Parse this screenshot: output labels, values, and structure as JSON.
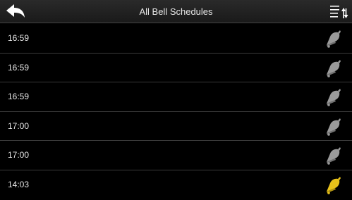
{
  "header": {
    "title": "All Bell Schedules",
    "back_icon": "back-arrow-icon",
    "sort_icon": "sort-list-icon"
  },
  "schedules": [
    {
      "time": "16:59",
      "enabled": false,
      "icon": "bell-icon"
    },
    {
      "time": "16:59",
      "enabled": false,
      "icon": "bell-icon"
    },
    {
      "time": "16:59",
      "enabled": false,
      "icon": "bell-icon"
    },
    {
      "time": "17:00",
      "enabled": false,
      "icon": "bell-icon"
    },
    {
      "time": "17:00",
      "enabled": false,
      "icon": "bell-icon"
    },
    {
      "time": "14:03",
      "enabled": true,
      "icon": "bell-icon"
    }
  ],
  "colors": {
    "bell_disabled": "#9a9a9a",
    "bell_enabled": "#e8c21a",
    "background": "#000000",
    "divider": "#3a3a3a"
  }
}
